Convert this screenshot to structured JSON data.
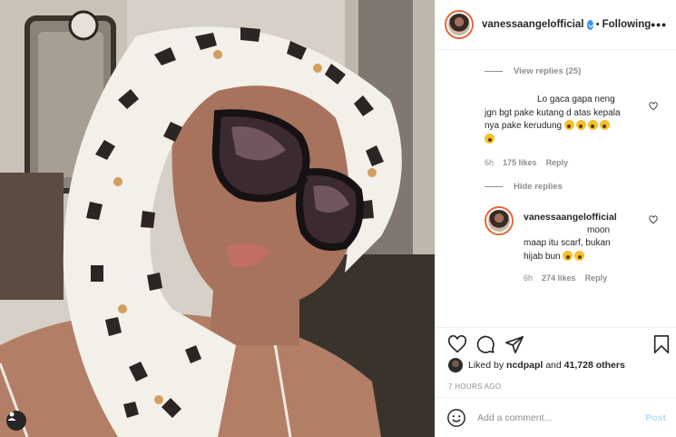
{
  "header": {
    "username": "vanessaangelofficial",
    "separator": "•",
    "follow_status": "Following",
    "more_label": "•••"
  },
  "comments": {
    "view_replies": "View replies (25)",
    "comment1": {
      "text_lines": [
        "Lo gaca gapa neng",
        "jgn bgt pake kutang d atas kepala",
        "nya pake kerudung"
      ],
      "time": "6h",
      "likes": "175 likes",
      "reply": "Reply"
    },
    "hide_replies": "Hide replies",
    "reply1": {
      "username": "vanessaangelofficial",
      "mention": "moon",
      "text_lines": [
        "maap itu scarf, bukan",
        "hijab bun"
      ],
      "time": "6h",
      "likes": "274 likes",
      "reply": "Reply"
    }
  },
  "actions": {
    "liked_prefix": "Liked by",
    "liked_user": "ncdpapl",
    "liked_and": "and",
    "liked_others": "41,728 others",
    "timestamp": "7 HOURS AGO"
  },
  "add_comment": {
    "placeholder": "Add a comment...",
    "post_label": "Post"
  },
  "colors": {
    "accent": "#3897f0",
    "muted": "#8e8e8e",
    "post_disabled": "#b2dffc"
  },
  "icons": [
    "heart-icon",
    "comment-icon",
    "share-icon",
    "bookmark-icon",
    "smile-icon",
    "user-tag-icon",
    "more-icon",
    "verified-icon"
  ]
}
